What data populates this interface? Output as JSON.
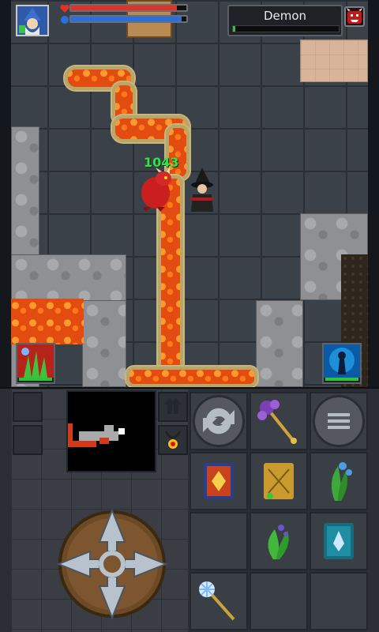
{
  "hud": {
    "player_health_pct": 92,
    "player_mana_pct": 96,
    "health_color": "#e03226",
    "mana_color": "#2a6fe0",
    "target": {
      "name": "Demon",
      "health_pct": 2
    }
  },
  "combat": {
    "damage_text": "1043"
  },
  "icons": {
    "player_avatar": "wizard-portrait-icon",
    "target_portrait": "demon-face-icon",
    "skill_left": "fire-plant-spell-icon",
    "skill_right": "blue-summon-spell-icon",
    "swap": "swap-arrows-icon",
    "weapon": "purple-staff-icon",
    "menu": "menu-lines-icon",
    "amulet": "amulet-icon"
  },
  "inventory": [
    {
      "icon": "red-spellbook-icon"
    },
    {
      "icon": "golden-spellbook-icon"
    },
    {
      "icon": "blue-herb-icon"
    },
    {
      "icon": "empty"
    },
    {
      "icon": "green-herb-icon"
    },
    {
      "icon": "teal-spellbook-icon"
    },
    {
      "icon": "ice-staff-icon"
    },
    {
      "icon": "empty"
    },
    {
      "icon": "empty"
    }
  ]
}
